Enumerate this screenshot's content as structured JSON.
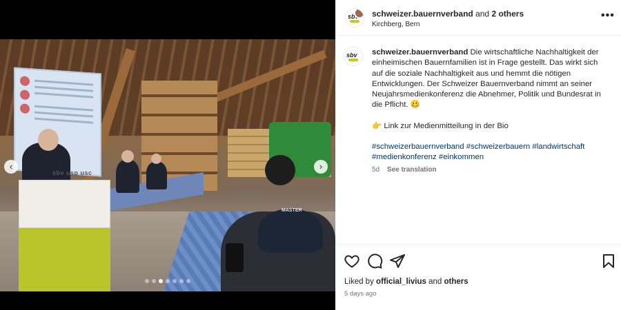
{
  "post": {
    "author": "schweizer.bauernverband",
    "coauthor_text": "and",
    "others_label": "2 others",
    "location": "Kirchberg, Bern",
    "more_icon": "more-horizontal-icon",
    "media": {
      "podium_logo": "sbv usp usc",
      "beanie_text": "MASTER",
      "slide_count": 7,
      "active_slide": 3,
      "prev_icon": "chevron-left-icon",
      "next_icon": "chevron-right-icon"
    }
  },
  "caption": {
    "author": "schweizer.bauernverband",
    "text_1": "Die wirtschaftliche Nachhaltigkeit der einheimischen Bauernfamilien ist in Frage gestellt. Das wirkt sich auf die soziale Nachhaltigkeit aus und hemmt die nötigen Entwicklungen. Der Schweizer Bauernverband nimmt an seiner Neujahrsmedienkonferenz die Abnehmer, Politik und Bundesrat in die Pflicht. 🥴",
    "text_2": "👉 Link zur Medienmitteilung in der Bio",
    "hashtags": "#schweizerbauernverband #schweizerbauern #landwirtschaft #medienkonferenz #einkommen",
    "age": "5d",
    "see_translation": "See translation"
  },
  "actions": {
    "like_icon": "heart-icon",
    "comment_icon": "comment-icon",
    "share_icon": "share-icon",
    "save_icon": "bookmark-icon",
    "liked_prefix": "Liked by",
    "liked_user": "official_livius",
    "liked_and": "and",
    "liked_others": "others",
    "posted_ago": "5 days ago"
  }
}
